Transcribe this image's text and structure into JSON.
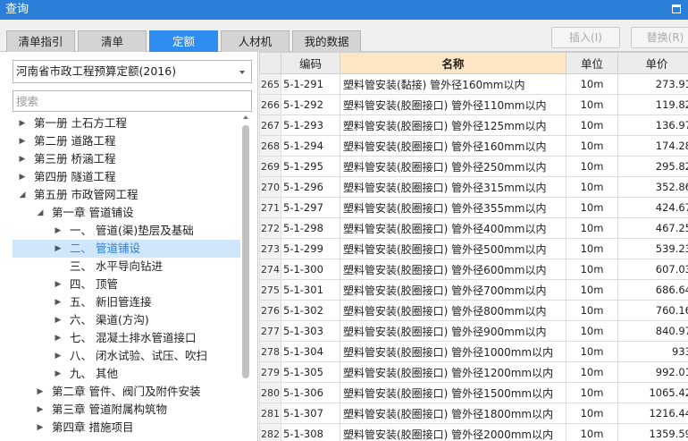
{
  "window": {
    "title": "查询"
  },
  "tabs": [
    {
      "label": "清单指引",
      "active": false
    },
    {
      "label": "清单",
      "active": false
    },
    {
      "label": "定额",
      "active": true
    },
    {
      "label": "人材机",
      "active": false
    },
    {
      "label": "我的数据",
      "active": false
    }
  ],
  "actions": {
    "insert_label": "插入(I)",
    "replace_label": "替换(R)"
  },
  "left": {
    "library_select": "河南省市政工程预算定额(2016)",
    "search_placeholder": "搜索"
  },
  "tree": [
    {
      "label": "第一册 土石方工程",
      "level": 0,
      "expand": "collapsed",
      "selected": false
    },
    {
      "label": "第二册 道路工程",
      "level": 0,
      "expand": "collapsed",
      "selected": false
    },
    {
      "label": "第三册 桥涵工程",
      "level": 0,
      "expand": "collapsed",
      "selected": false
    },
    {
      "label": "第四册 隧道工程",
      "level": 0,
      "expand": "collapsed",
      "selected": false
    },
    {
      "label": "第五册 市政管网工程",
      "level": 0,
      "expand": "expanded",
      "selected": false
    },
    {
      "label": "第一章 管道铺设",
      "level": 1,
      "expand": "expanded",
      "selected": false
    },
    {
      "label": "一、 管道(渠)垫层及基础",
      "level": 2,
      "expand": "collapsed",
      "selected": false
    },
    {
      "label": "二、 管道铺设",
      "level": 2,
      "expand": "collapsed",
      "selected": true
    },
    {
      "label": "三、 水平导向钻进",
      "level": 2,
      "expand": "none",
      "selected": false
    },
    {
      "label": "四、 顶管",
      "level": 2,
      "expand": "collapsed",
      "selected": false
    },
    {
      "label": "五、 新旧管连接",
      "level": 2,
      "expand": "collapsed",
      "selected": false
    },
    {
      "label": "六、 渠道(方沟)",
      "level": 2,
      "expand": "collapsed",
      "selected": false
    },
    {
      "label": "七、 混凝土排水管道接口",
      "level": 2,
      "expand": "collapsed",
      "selected": false
    },
    {
      "label": "八、 闭水试验、试压、吹扫",
      "level": 2,
      "expand": "collapsed",
      "selected": false
    },
    {
      "label": "九、 其他",
      "level": 2,
      "expand": "collapsed",
      "selected": false
    },
    {
      "label": "第二章 管件、阀门及附件安装",
      "level": 1,
      "expand": "collapsed",
      "selected": false
    },
    {
      "label": "第三章 管道附属构筑物",
      "level": 1,
      "expand": "collapsed",
      "selected": false
    },
    {
      "label": "第四章 措施项目",
      "level": 1,
      "expand": "collapsed",
      "selected": false
    }
  ],
  "table": {
    "columns": [
      "编码",
      "名称",
      "单位",
      "单价"
    ],
    "rows": [
      {
        "no": "265",
        "code": "5-1-291",
        "name": "塑料管安装(黏接) 管外径160mm以内",
        "unit": "10m",
        "price": "273.91"
      },
      {
        "no": "266",
        "code": "5-1-292",
        "name": "塑料管安装(胶圈接口) 管外径110mm以内",
        "unit": "10m",
        "price": "119.82"
      },
      {
        "no": "267",
        "code": "5-1-293",
        "name": "塑料管安装(胶圈接口) 管外径125mm以内",
        "unit": "10m",
        "price": "136.97"
      },
      {
        "no": "268",
        "code": "5-1-294",
        "name": "塑料管安装(胶圈接口) 管外径160mm以内",
        "unit": "10m",
        "price": "174.28"
      },
      {
        "no": "269",
        "code": "5-1-295",
        "name": "塑料管安装(胶圈接口) 管外径250mm以内",
        "unit": "10m",
        "price": "295.82"
      },
      {
        "no": "270",
        "code": "5-1-296",
        "name": "塑料管安装(胶圈接口) 管外径315mm以内",
        "unit": "10m",
        "price": "352.86"
      },
      {
        "no": "271",
        "code": "5-1-297",
        "name": "塑料管安装(胶圈接口) 管外径355mm以内",
        "unit": "10m",
        "price": "424.67"
      },
      {
        "no": "272",
        "code": "5-1-298",
        "name": "塑料管安装(胶圈接口) 管外径400mm以内",
        "unit": "10m",
        "price": "467.25"
      },
      {
        "no": "273",
        "code": "5-1-299",
        "name": "塑料管安装(胶圈接口) 管外径500mm以内",
        "unit": "10m",
        "price": "539.23"
      },
      {
        "no": "274",
        "code": "5-1-300",
        "name": "塑料管安装(胶圈接口) 管外径600mm以内",
        "unit": "10m",
        "price": "607.03"
      },
      {
        "no": "275",
        "code": "5-1-301",
        "name": "塑料管安装(胶圈接口) 管外径700mm以内",
        "unit": "10m",
        "price": "686.64"
      },
      {
        "no": "276",
        "code": "5-1-302",
        "name": "塑料管安装(胶圈接口) 管外径800mm以内",
        "unit": "10m",
        "price": "760.16"
      },
      {
        "no": "277",
        "code": "5-1-303",
        "name": "塑料管安装(胶圈接口) 管外径900mm以内",
        "unit": "10m",
        "price": "840.97"
      },
      {
        "no": "278",
        "code": "5-1-304",
        "name": "塑料管安装(胶圈接口) 管外径1000mm以内",
        "unit": "10m",
        "price": "933"
      },
      {
        "no": "279",
        "code": "5-1-305",
        "name": "塑料管安装(胶圈接口) 管外径1200mm以内",
        "unit": "10m",
        "price": "992.01"
      },
      {
        "no": "280",
        "code": "5-1-306",
        "name": "塑料管安装(胶圈接口) 管外径1500mm以内",
        "unit": "10m",
        "price": "1065.42"
      },
      {
        "no": "281",
        "code": "5-1-307",
        "name": "塑料管安装(胶圈接口) 管外径1800mm以内",
        "unit": "10m",
        "price": "1216.44"
      },
      {
        "no": "282",
        "code": "5-1-308",
        "name": "塑料管安装(胶圈接口) 管外径2000mm以内",
        "unit": "10m",
        "price": "1359.59"
      }
    ]
  },
  "colors": {
    "title_bar": "#2b7fd8",
    "active_tab": "#2f8cf0",
    "name_header": "#fde6c4",
    "selected_row": "#cfe6fb"
  },
  "icons": {
    "maximize": "maximize-icon",
    "dropdown": "chevron-down-icon",
    "expand_collapsed": "triangle-right-icon",
    "expand_open": "triangle-down-icon"
  }
}
